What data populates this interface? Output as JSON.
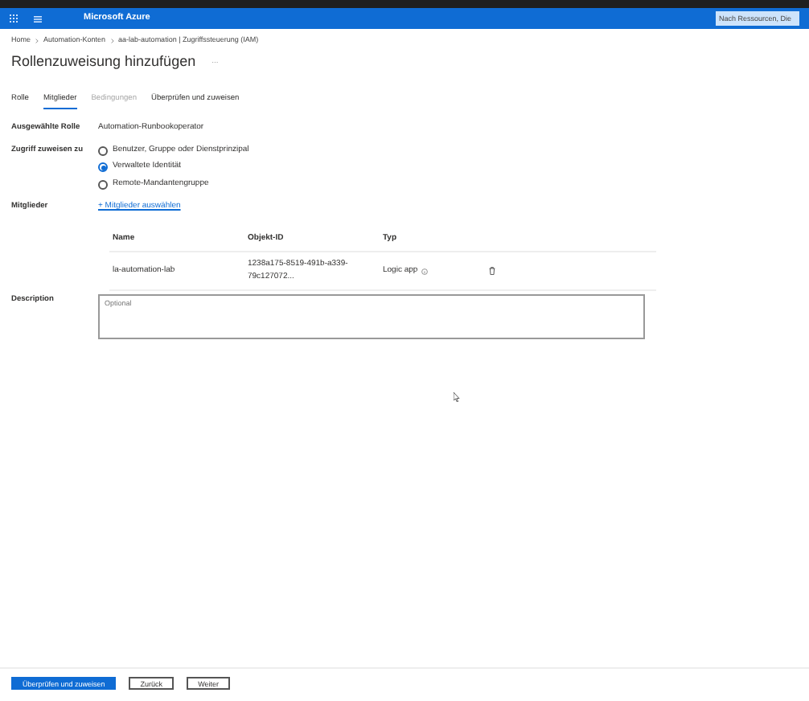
{
  "topbar": {
    "brand": "Microsoft Azure",
    "search": {
      "placeholder": "Nach Ressourcen, Die"
    }
  },
  "breadcrumb": [
    "Home",
    "Automation-Konten",
    "aa-lab-automation | Zugriffssteuerung (IAM)"
  ],
  "title": "Rollenzuweisung hinzufügen",
  "title_more": "...",
  "tabs": [
    {
      "label": "Rolle",
      "selected": false,
      "disabled": false
    },
    {
      "label": "Mitglieder",
      "selected": true,
      "disabled": false
    },
    {
      "label": "Bedingungen",
      "selected": false,
      "disabled": true
    },
    {
      "label": "Überprüfen und zuweisen",
      "selected": false,
      "disabled": false
    }
  ],
  "selected_role": {
    "label": "Ausgewählte Rolle",
    "value": "Automation-Runbookoperator"
  },
  "assign_access": {
    "label": "Zugriff zuweisen zu",
    "options": [
      {
        "label": "Benutzer, Gruppe oder Dienstprinzipal",
        "selected": false
      },
      {
        "label": "Verwaltete Identität",
        "selected": true
      },
      {
        "label": "Remote-Mandantengruppe",
        "selected": false
      }
    ]
  },
  "members": {
    "label": "Mitglieder",
    "add_link": "+ Mitglieder auswählen",
    "table": {
      "columns": [
        "Name",
        "Objekt-ID",
        "Typ"
      ],
      "rows": [
        {
          "name": "la-automation-lab",
          "object_id": "1238a175-8519-491b-a339-79c127072...",
          "type": "Logic app"
        }
      ]
    }
  },
  "description": {
    "label": "Description",
    "placeholder": "Optional"
  },
  "footer": {
    "buttons": [
      {
        "label": "Überprüfen und zuweisen",
        "kind": "primary"
      },
      {
        "label": "Zurück",
        "kind": "secondary"
      },
      {
        "label": "Weiter",
        "kind": "secondary"
      }
    ]
  }
}
